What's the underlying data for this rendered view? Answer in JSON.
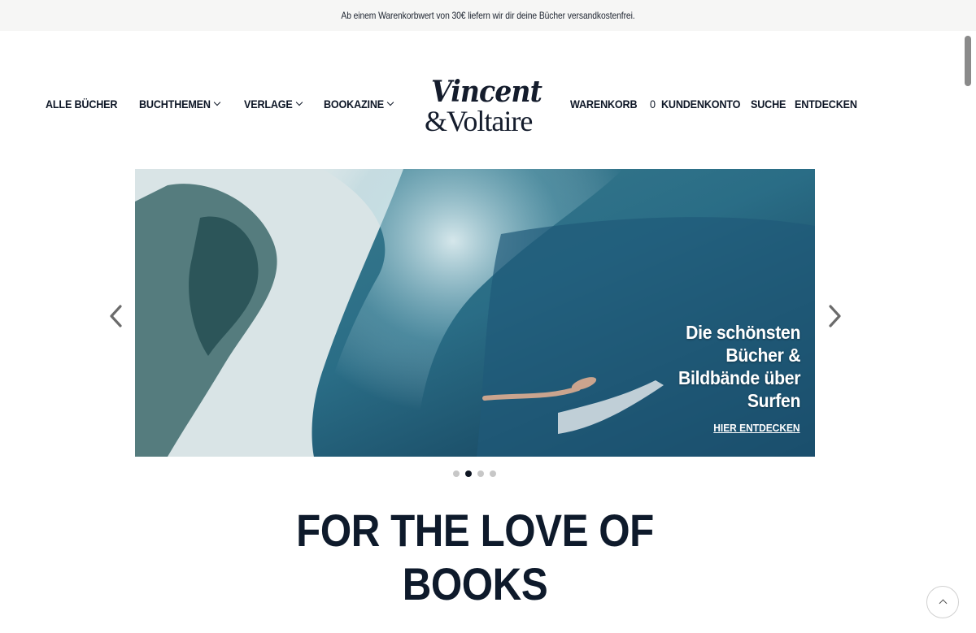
{
  "announcement": {
    "text": "Ab einem Warenkorbwert von 30€ liefern wir dir deine Bücher versandkostenfrei."
  },
  "nav_left": [
    {
      "label": "ALLE BÜCHER",
      "dropdown": false
    },
    {
      "label": "BUCHTHEMEN",
      "dropdown": true
    },
    {
      "label": "VERLAGE",
      "dropdown": true
    },
    {
      "label": "BOOKAZINE",
      "dropdown": true
    }
  ],
  "logo": {
    "line1": "Vincent",
    "line2": "&Voltaire"
  },
  "nav_right": {
    "cart_label": "WARENKORB",
    "cart_count": "0",
    "account_label": "KUNDENKONTO",
    "search_label": "SUCHE",
    "discover_label": "ENTDECKEN"
  },
  "hero": {
    "title_lines": [
      "Die schönsten",
      "Bücher &",
      "Bildbände über",
      "Surfen"
    ],
    "cta": "HIER ENTDECKEN",
    "slide_count": 4,
    "active_slide": 2
  },
  "icons": {
    "prev": "chevron-left-icon",
    "next": "chevron-right-icon",
    "dropdown": "chevron-down-icon",
    "back_to_top": "chevron-up-icon"
  },
  "colors": {
    "text": "#0e1a2b",
    "announcement_bg": "#f6f6f5",
    "dot_active": "#0e1522",
    "dot_inactive": "#c7c7c7"
  },
  "headline": {
    "lines": [
      "FOR THE LOVE OF",
      "BOOKS"
    ]
  }
}
